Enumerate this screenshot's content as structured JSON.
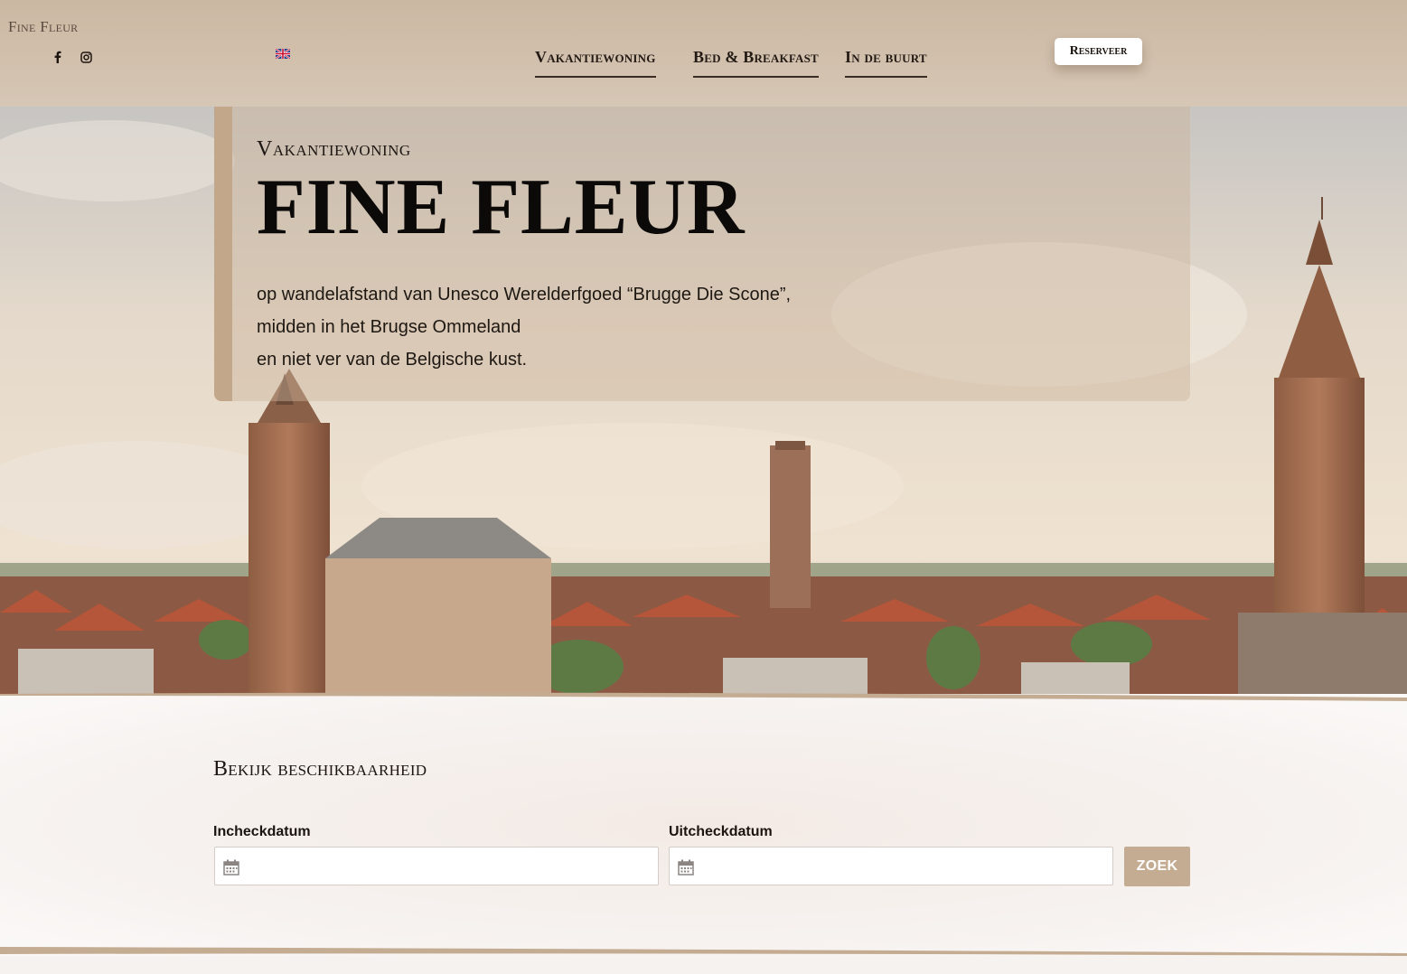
{
  "header": {
    "brand": "Fine Fleur",
    "social": [
      "facebook-icon",
      "instagram-icon"
    ],
    "language_flag": "uk-flag-icon",
    "nav": [
      {
        "label": "Vakantiewoning"
      },
      {
        "label": "Bed & Breakfast"
      },
      {
        "label": "In de buurt"
      }
    ],
    "reserve_label": "Reserveer"
  },
  "hero": {
    "kicker": "Vakantiewoning",
    "title": "FINE FLEUR",
    "intro": [
      "op wandelafstand van Unesco Werelderfgoed “Brugge Die Scone”,",
      "midden in het Brugse Ommeland",
      "en niet ver van de Belgische kust."
    ]
  },
  "availability": {
    "title": "Bekijk beschikbaarheid",
    "checkin_label": "Incheckdatum",
    "checkout_label": "Uitcheckdatum",
    "checkin_value": "",
    "checkout_value": "",
    "search_label": "ZOEK"
  },
  "colors": {
    "header_bg": "#cbb8a2",
    "accent": "#c4ac93",
    "panel_bar": "#c2a78b",
    "text_dark": "#1b1410"
  }
}
